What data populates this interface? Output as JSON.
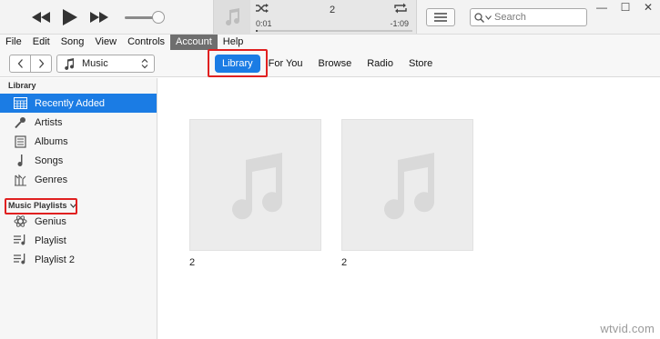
{
  "player": {
    "track_title": "2",
    "elapsed": "0:01",
    "remaining": "-1:09",
    "progress_fraction": 0.01,
    "volume_fraction": 0.8
  },
  "search": {
    "placeholder": "Search",
    "value": ""
  },
  "window": {
    "minimize": "—",
    "maximize": "☐",
    "close": "✕"
  },
  "menu": {
    "items": [
      {
        "label": "File"
      },
      {
        "label": "Edit"
      },
      {
        "label": "Song"
      },
      {
        "label": "View"
      },
      {
        "label": "Controls"
      },
      {
        "label": "Account",
        "active": true
      },
      {
        "label": "Help"
      }
    ]
  },
  "nav": {
    "media_kind": "Music",
    "tabs": [
      {
        "label": "Library",
        "selected": true
      },
      {
        "label": "For You"
      },
      {
        "label": "Browse"
      },
      {
        "label": "Radio"
      },
      {
        "label": "Store"
      }
    ]
  },
  "sidebar": {
    "library_heading": "Library",
    "library_items": [
      {
        "label": "Recently Added",
        "icon": "grid-icon",
        "selected": true
      },
      {
        "label": "Artists",
        "icon": "microphone-icon"
      },
      {
        "label": "Albums",
        "icon": "album-icon"
      },
      {
        "label": "Songs",
        "icon": "music-note-icon"
      },
      {
        "label": "Genres",
        "icon": "genres-icon"
      }
    ],
    "playlists_heading": "Music Playlists",
    "playlist_items": [
      {
        "label": "Genius",
        "icon": "genius-atom-icon"
      },
      {
        "label": "Playlist",
        "icon": "playlist-icon"
      },
      {
        "label": "Playlist 2",
        "icon": "playlist-icon"
      }
    ]
  },
  "albums": [
    {
      "title": "2"
    },
    {
      "title": "2"
    }
  ],
  "watermark": "wtvid.com",
  "colors": {
    "accent": "#1b7ce4",
    "highlight_box": "#e02020",
    "menu_active": "#6e6e6e"
  }
}
